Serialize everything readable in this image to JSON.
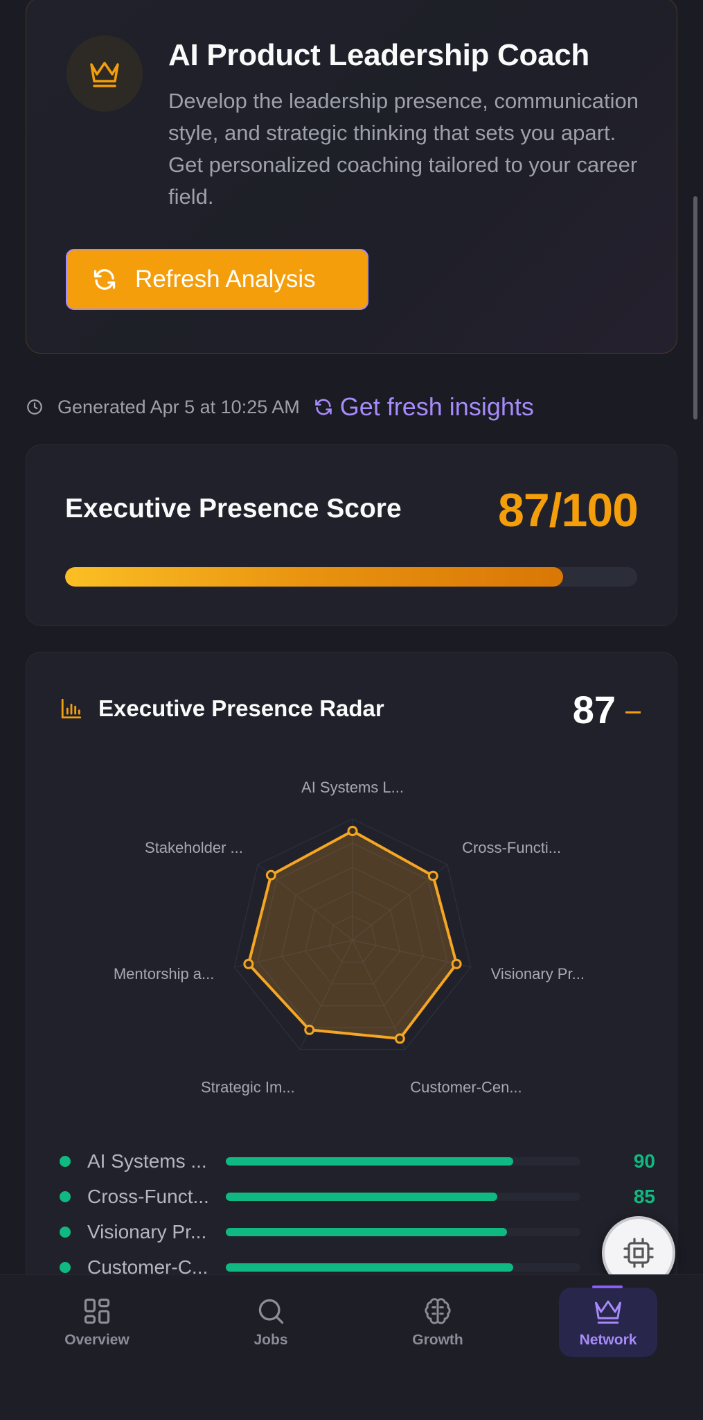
{
  "hero": {
    "title": "AI Product Leadership Coach",
    "description": "Develop the leadership presence, communication style, and strategic thinking that sets you apart. Get personalized coaching tailored to your career field.",
    "refresh_label": "Refresh Analysis",
    "icon": "crown-icon"
  },
  "meta": {
    "generated": "Generated Apr 5 at 10:25 AM",
    "fresh_link": "Get fresh insights"
  },
  "score": {
    "label": "Executive Presence Score",
    "value_text": "87/100",
    "value": 87,
    "max": 100
  },
  "radar": {
    "title": "Executive Presence Radar",
    "score": "87",
    "trend": "–"
  },
  "chart_data": {
    "type": "radar",
    "axes": [
      "AI Systems L...",
      "Cross-Functi...",
      "Visionary Pr...",
      "Customer-Cen...",
      "Strategic Im...",
      "Mentorship a...",
      "Stakeholder ..."
    ],
    "values": [
      90,
      85,
      88,
      90,
      82,
      88,
      86
    ],
    "range": [
      0,
      100
    ],
    "color": "#f5a623"
  },
  "skills": [
    {
      "name": "AI Systems ...",
      "value": 90,
      "label": "90"
    },
    {
      "name": "Cross-Funct...",
      "value": 85,
      "label": "85"
    },
    {
      "name": "Visionary Pr...",
      "value": 88,
      "label": ""
    },
    {
      "name": "Customer-C...",
      "value": 90,
      "label": ""
    }
  ],
  "nav": {
    "items": [
      {
        "label": "Overview",
        "icon": "grid-icon"
      },
      {
        "label": "Jobs",
        "icon": "search-icon"
      },
      {
        "label": "Growth",
        "icon": "brain-icon"
      },
      {
        "label": "Network",
        "icon": "crown-icon"
      }
    ],
    "active": "Network"
  },
  "colors": {
    "accent": "#f59e0b",
    "purple": "#a78bfa",
    "green": "#10b981"
  }
}
